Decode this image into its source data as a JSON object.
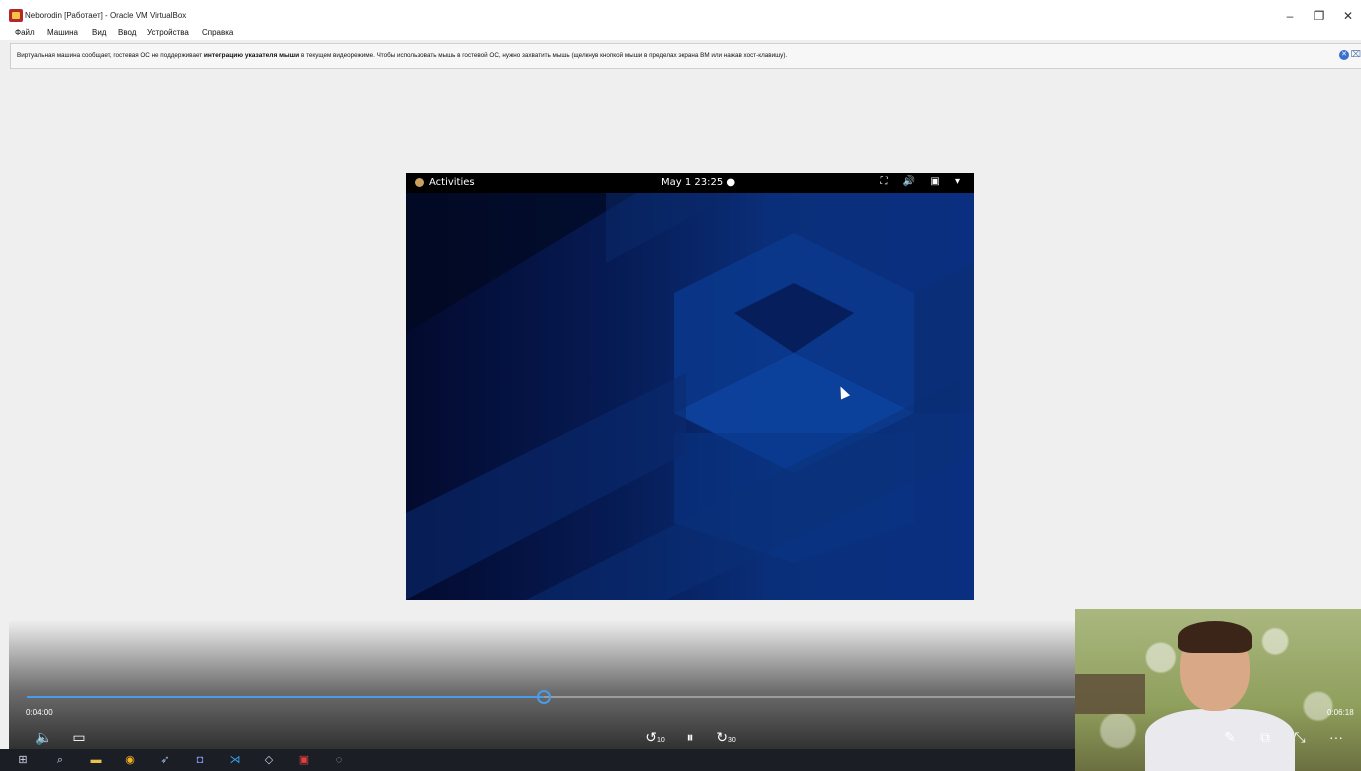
{
  "window": {
    "title": "Neborodin [Работает] - Oracle VM VirtualBox",
    "controls": {
      "minimize": "–",
      "restore": "❐",
      "close": "✕"
    }
  },
  "menu": [
    "Файл",
    "Машина",
    "Вид",
    "Ввод",
    "Устройства",
    "Справка"
  ],
  "notice": {
    "text_before": "Виртуальная машина сообщает, гостевая ОС не поддерживает ",
    "bold": "интеграцию указателя мыши",
    "text_after": " в текущем видеорежиме. Чтобы использовать мышь в гостевой ОС, нужно захватить мышь (щелкнув кнопкой мыши в пределах экрана ВМ или нажав хост-клавишу)."
  },
  "guest": {
    "activities": "Activities",
    "clock": "May 1  23:25 ●",
    "tray_icons": [
      "network-icon",
      "volume-icon",
      "battery-icon",
      "menu-arrow-icon"
    ],
    "tray_glyphs": "⛶ 🔊 ▣ ▾"
  },
  "player": {
    "elapsed": "0:04:00",
    "total": "0:06:18",
    "progress": 0.39,
    "accent": "#4a9be8",
    "buttons": {
      "volume": "🔈",
      "captions": "▭",
      "rewind": "↺",
      "rewind_sec": "10",
      "pause": "⏸",
      "forward": "↻",
      "forward_sec": "30",
      "edit": "✎",
      "miniplayer": "⧉",
      "collapse": "⤡",
      "more": "···"
    }
  },
  "taskbar": {
    "icons": [
      "windows-start-icon",
      "search-icon",
      "file-explorer-icon",
      "chrome-icon",
      "steam-icon",
      "discord-icon",
      "vscode-icon",
      "virtualbox-icon",
      "app-red-icon",
      "obs-icon"
    ],
    "glyphs": [
      "⊞",
      "⌕",
      "▬",
      "◉",
      "➶",
      "◘",
      "⋊",
      "◇",
      "▣",
      "◌"
    ]
  }
}
